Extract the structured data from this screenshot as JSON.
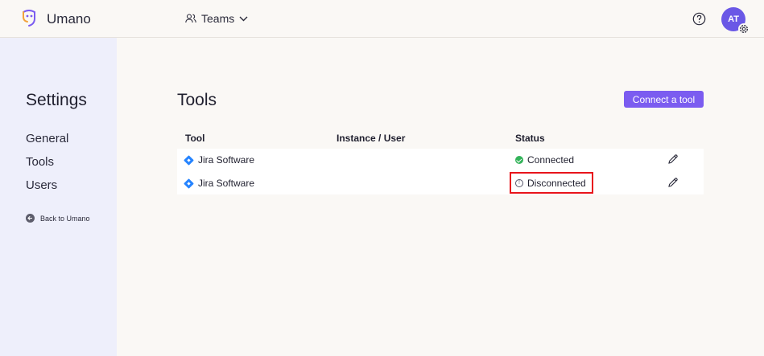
{
  "header": {
    "brand": "Umano",
    "teams_label": "Teams",
    "avatar_initials": "AT"
  },
  "sidebar": {
    "title": "Settings",
    "items": [
      {
        "label": "General"
      },
      {
        "label": "Tools"
      },
      {
        "label": "Users"
      }
    ],
    "back_label": "Back to Umano"
  },
  "main": {
    "title": "Tools",
    "connect_label": "Connect a tool",
    "columns": [
      "Tool",
      "Instance / User",
      "Status"
    ],
    "rows": [
      {
        "tool": "Jira Software",
        "instance": "",
        "status": "Connected"
      },
      {
        "tool": "Jira Software",
        "instance": "",
        "status": "Disconnected"
      }
    ]
  },
  "colors": {
    "accent": "#7b5cf0",
    "avatar": "#6a58e6",
    "sidebar_bg": "#eeeffb",
    "connected": "#34b35a",
    "highlight": "#e8141b"
  }
}
